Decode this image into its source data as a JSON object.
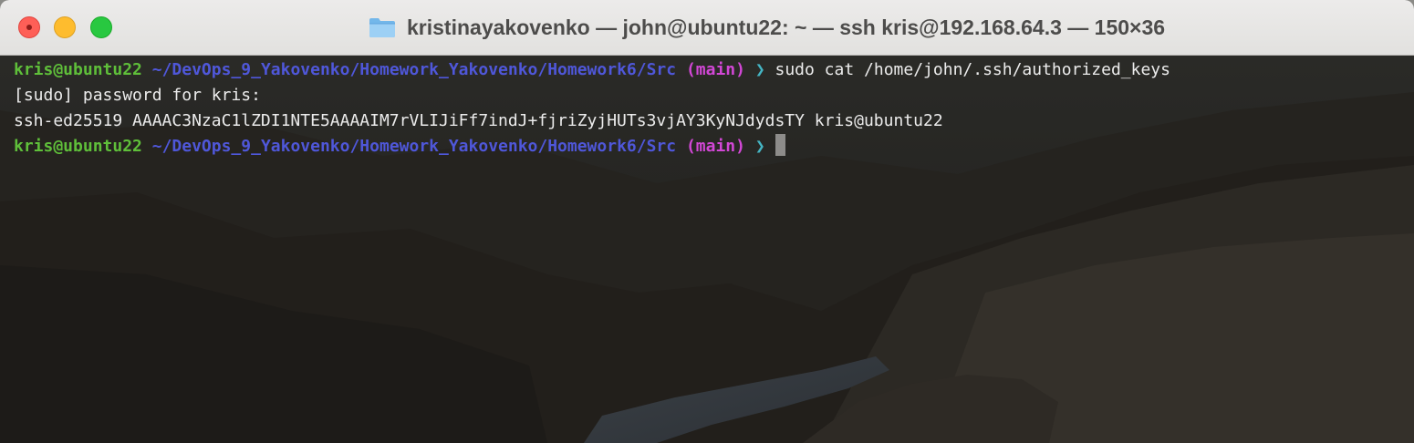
{
  "window": {
    "title": "kristinayakovenko — john@ubuntu22: ~ — ssh kris@192.168.64.3 — 150×36",
    "title_icon": "folder-icon",
    "buttons": [
      "close",
      "minimize",
      "zoom"
    ]
  },
  "terminal": {
    "lines": [
      {
        "type": "prompt",
        "user": "kris@ubuntu22",
        "path": "~/DevOps_9_Yakovenko/Homework_Yakovenko/Homework6/Src",
        "branch": "(main)",
        "arrow": "❯",
        "command": "sudo cat /home/john/.ssh/authorized_keys"
      },
      {
        "type": "output",
        "text": "[sudo] password for kris:"
      },
      {
        "type": "output",
        "text": "ssh-ed25519 AAAAC3NzaC1lZDI1NTE5AAAAIM7rVLIJiFf7indJ+fjriZyjHUTs3vjAY3KyNJdydsTY kris@ubuntu22"
      },
      {
        "type": "prompt",
        "user": "kris@ubuntu22",
        "path": "~/DevOps_9_Yakovenko/Homework_Yakovenko/Homework6/Src",
        "branch": "(main)",
        "arrow": "❯",
        "command": ""
      }
    ]
  },
  "colors": {
    "user": "#5fbf3a",
    "path": "#4f57d9",
    "branch": "#d247d6",
    "arrow": "#45b5c4",
    "text": "#ececec",
    "cursor": "#8d8c8a"
  }
}
